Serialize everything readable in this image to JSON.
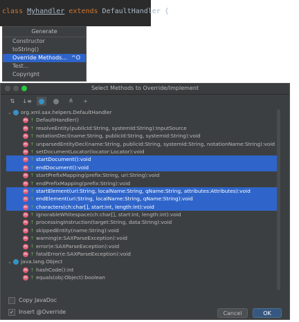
{
  "editor": {
    "kw_class": "class",
    "class_name": "Myhandler",
    "kw_extends": "extends",
    "parent": "DefaultHandler",
    "brace": "{"
  },
  "generate_menu": {
    "title": "Generate",
    "items": [
      {
        "label": "Constructor"
      },
      {
        "label": "toString()"
      },
      {
        "label": "Override Methods...",
        "shortcut": "^O",
        "selected": true
      },
      {
        "label": "Test..."
      },
      {
        "label": "Copyright"
      }
    ]
  },
  "dialog": {
    "title": "Select Methods to Override/Implement",
    "toolbar_icons": [
      "sort-alpha-icon",
      "sort-visibility-icon",
      "show-classes-icon",
      "circle-icon",
      "expand-all-icon",
      "collapse-all-icon"
    ],
    "tree": [
      {
        "kind": "class",
        "label": "org.xml.sax.helpers.DefaultHandler"
      },
      {
        "kind": "method",
        "label": "DefaultHandler()"
      },
      {
        "kind": "method",
        "label": "resolveEntity(publicId:String, systemId:String):InputSource"
      },
      {
        "kind": "method",
        "label": "notationDecl(name:String, publicId:String, systemId:String):void"
      },
      {
        "kind": "method",
        "label": "unparsedEntityDecl(name:String, publicId:String, systemId:String, notationName:String):void"
      },
      {
        "kind": "method",
        "label": "setDocumentLocator(locator:Locator):void"
      },
      {
        "kind": "method",
        "label": "startDocument():void",
        "selected": true
      },
      {
        "kind": "method",
        "label": "endDocument():void",
        "selected": true
      },
      {
        "kind": "method",
        "label": "startPrefixMapping(prefix:String, uri:String):void"
      },
      {
        "kind": "method",
        "label": "endPrefixMapping(prefix:String):void"
      },
      {
        "kind": "method",
        "label": "startElement(uri:String, localName:String, qName:String, attributes:Attributes):void",
        "selected": true
      },
      {
        "kind": "method",
        "label": "endElement(uri:String, localName:String, qName:String):void",
        "selected": true
      },
      {
        "kind": "method",
        "label": "characters(ch:char[], start:int, length:int):void",
        "selected": true
      },
      {
        "kind": "method",
        "label": "ignorableWhitespace(ch:char[], start:int, length:int):void"
      },
      {
        "kind": "method",
        "label": "processingInstruction(target:String, data:String):void"
      },
      {
        "kind": "method",
        "label": "skippedEntity(name:String):void"
      },
      {
        "kind": "method",
        "label": "warning(e:SAXParseException):void"
      },
      {
        "kind": "method",
        "label": "error(e:SAXParseException):void"
      },
      {
        "kind": "method",
        "label": "fatalError(e:SAXParseException):void"
      },
      {
        "kind": "class",
        "label": "java.lang.Object"
      },
      {
        "kind": "method",
        "label": "hashCode():int"
      },
      {
        "kind": "method",
        "label": "equals(obj:Object):boolean"
      }
    ],
    "copy_javadoc": {
      "label": "Copy JavaDoc",
      "checked": false
    },
    "insert_override": {
      "label": "Insert @Override",
      "checked": true
    },
    "cancel_label": "Cancel",
    "ok_label": "OK"
  },
  "colors": {
    "selection": "#2f65ca",
    "dialog_bg": "#3c3f41",
    "method_icon": "#e05c75",
    "class_icon": "#3592c4"
  }
}
